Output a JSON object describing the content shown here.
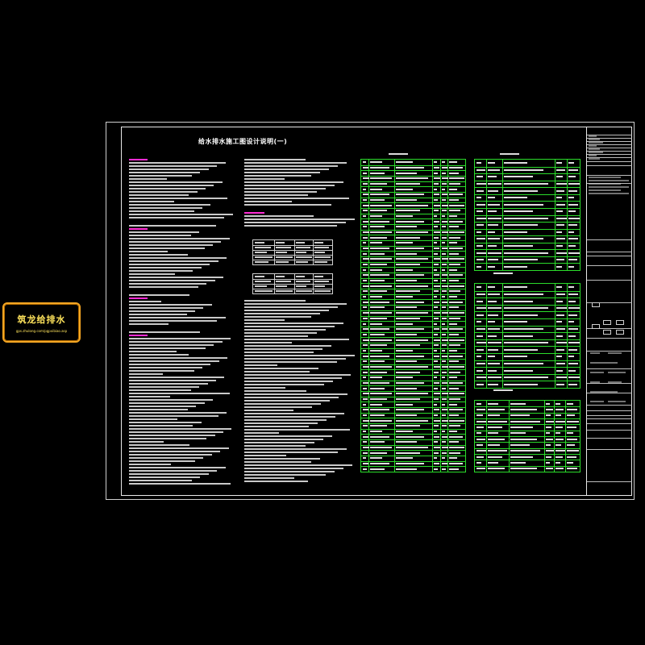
{
  "drawing": {
    "title": "给水排水施工图设计说明(一)"
  },
  "logo": {
    "main_text": "筑龙给排水",
    "sub_text": "gps.zhulong.com/pgpxibiao.asp",
    "border_color": "#f5a623",
    "text_color": "#ffe45c"
  },
  "colors": {
    "background": "#000000",
    "heading_magenta": "#ff2bd4",
    "table_green": "#2bdc2b",
    "text_white": "#ffffff"
  }
}
